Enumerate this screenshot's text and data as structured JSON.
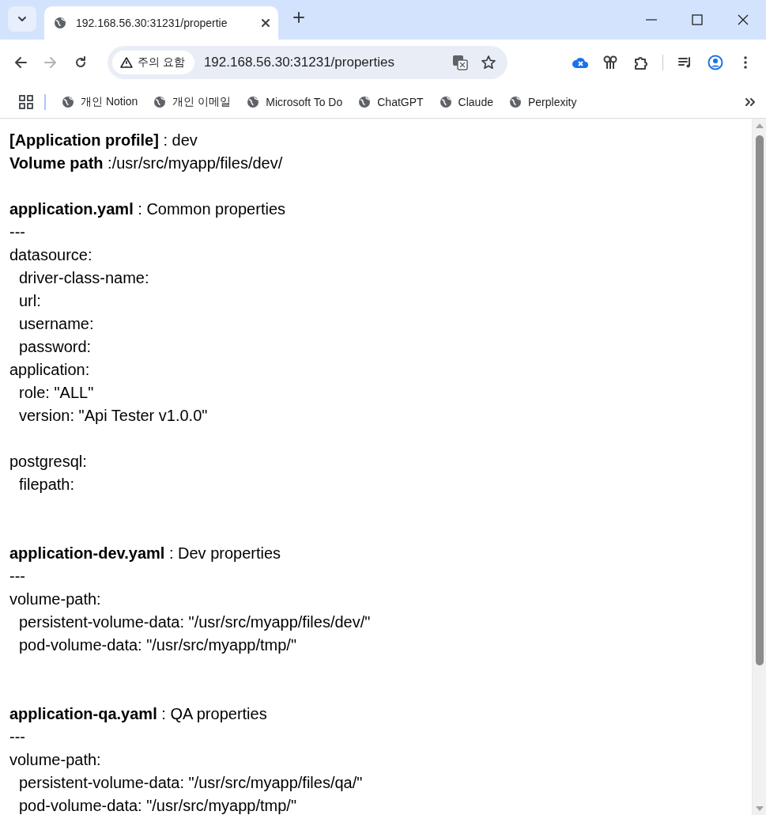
{
  "browser": {
    "tab": {
      "title": "192.168.56.30:31231/propertie",
      "selected": true
    },
    "navigation": {
      "back_enabled": true,
      "forward_enabled": false
    },
    "security_chip": "주의 요함",
    "address": "192.168.56.30:31231/properties",
    "bookmarks": [
      "개인 Notion",
      "개인 이메일",
      "Microsoft To Do",
      "ChatGPT",
      "Claude",
      "Perplexity"
    ]
  },
  "page": {
    "header": [
      "**[Application profile]** : dev",
      "**Volume path** :/usr/src/myapp/files/dev/"
    ],
    "sections": [
      {
        "title": "**application.yaml** : Common properties",
        "separator": "---",
        "groups": [
          [
            {
              "text": "datasource:",
              "children": [
                {
                  "text": "driver-class-name:"
                },
                {
                  "text": "url:"
                },
                {
                  "text": "username:"
                },
                {
                  "text": "password:"
                }
              ]
            },
            {
              "text": "application:",
              "children": [
                {
                  "text": "role: \"ALL\""
                },
                {
                  "text": "version: \"Api Tester v1.0.0\""
                }
              ]
            }
          ],
          [
            {
              "text": "postgresql:",
              "children": [
                {
                  "text": "filepath:"
                }
              ]
            }
          ]
        ]
      },
      {
        "title": "**application-dev.yaml** : Dev properties",
        "separator": "---",
        "groups": [
          [
            {
              "text": "volume-path:",
              "children": [
                {
                  "text": "persistent-volume-data: \"/usr/src/myapp/files/dev/\""
                },
                {
                  "text": "pod-volume-data: \"/usr/src/myapp/tmp/\""
                }
              ]
            }
          ]
        ]
      },
      {
        "title": "**application-qa.yaml** : QA properties",
        "separator": "---",
        "groups": [
          [
            {
              "text": "volume-path:",
              "children": [
                {
                  "text": "persistent-volume-data: \"/usr/src/myapp/files/qa/\""
                },
                {
                  "text": "pod-volume-data: \"/usr/src/myapp/tmp/\""
                }
              ]
            }
          ]
        ]
      }
    ]
  }
}
